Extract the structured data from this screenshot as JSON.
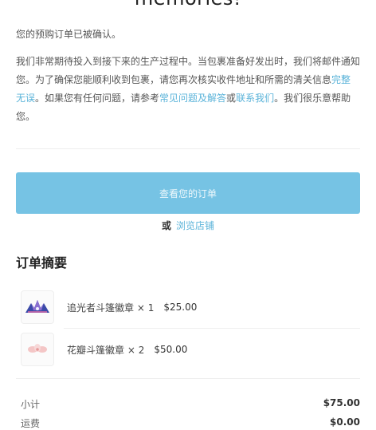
{
  "heading": {
    "text": "memories!"
  },
  "confirmation": {
    "text": "您的预购订单已被确认。"
  },
  "message": {
    "part1": "我们非常期待投入到接下来的生产过程中。当包裹准备好发出时，我们将邮件通知您。为了确保您能顺利收到包裹，请您再次核实收件地址和所需的清关信息",
    "link_complete": "完整无误",
    "part2": "。如果您有任何问题，请参考",
    "link_faq": "常见问题及解答",
    "part3": "或",
    "link_contact": "联系我们",
    "part4": "。我们很乐意帮助您。"
  },
  "actions": {
    "view_order_label": "查看您的订单",
    "or_label": "或",
    "browse_store_label": "浏览店铺"
  },
  "order_summary": {
    "title": "订单摘要",
    "items": [
      {
        "name": "追光者斗篷徽章",
        "quantity": "× 1",
        "price": "$25.00",
        "icon": "badge-thumbnail-icon"
      },
      {
        "name": "花瓣斗篷徽章",
        "quantity": "× 2",
        "price": "$50.00",
        "icon": "badge-thumbnail-icon"
      }
    ],
    "subtotal_label": "小计",
    "subtotal_value": "$75.00",
    "shipping_label": "运费",
    "shipping_value": "$0.00"
  },
  "colors": {
    "accent": "#76c3e4",
    "link": "#5ab3d9"
  }
}
